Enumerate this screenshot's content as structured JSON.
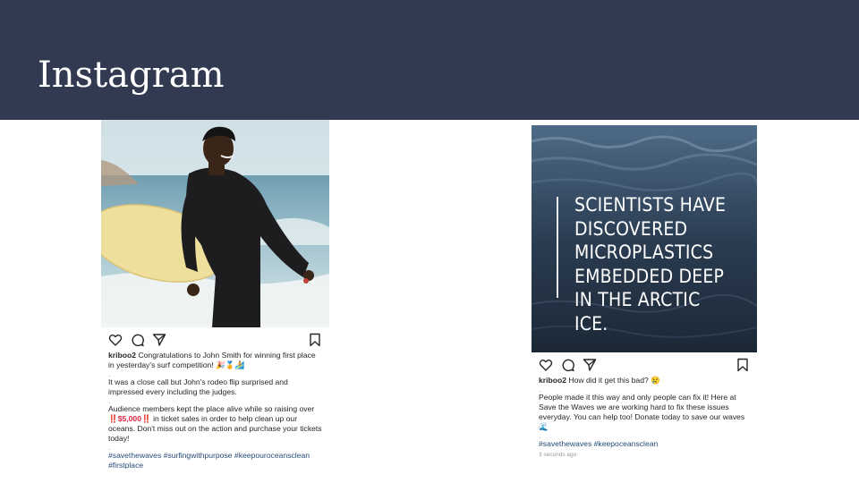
{
  "slide": {
    "title": "Instagram"
  },
  "colors": {
    "header_bg": "#313a50",
    "hashtag": "#274c77",
    "ocean": "#2b3d52"
  },
  "post_left": {
    "image": "surfer-photo",
    "username": "kriboo2",
    "caption_1": "Congratulations to John Smith for winning first place in yesterday's surf competition! 🎉🏅🏄",
    "dot": ".",
    "caption_2": "It was a close call but John's rodeo flip surprised and impressed every including the judges.",
    "caption_3a": "Audience members kept the place alive while so raising over ",
    "caption_3b": "‼️$5,000‼️",
    "caption_3c": " in ticket sales in order to help clean up our oceans. Don't miss out on the action and purchase your tickets today!",
    "hashtags": "#savethewaves #surfingwithpurpose #keepouroceansclean #firstplace",
    "icons": [
      "heart-icon",
      "comment-icon",
      "share-icon",
      "bookmark-icon"
    ]
  },
  "post_right": {
    "image": "ocean-water",
    "overlay_text": "SCIENTISTS HAVE\nDISCOVERED\nMICROPLASTICS\nEMBEDDED DEEP\nIN THE ARCTIC\nICE.",
    "username": "kriboo2",
    "caption_1": "How did it get this bad? 😢",
    "dot": ".",
    "caption_2": "People made it this way and only people can fix it! Here at Save the Waves we are working hard to fix these issues everyday. You can help too! Donate today to save our waves 🌊",
    "hashtags": "#savethewaves #keepoceansclean",
    "timestamp": "3 seconds ago",
    "icons": [
      "heart-icon",
      "comment-icon",
      "share-icon",
      "bookmark-icon"
    ]
  }
}
